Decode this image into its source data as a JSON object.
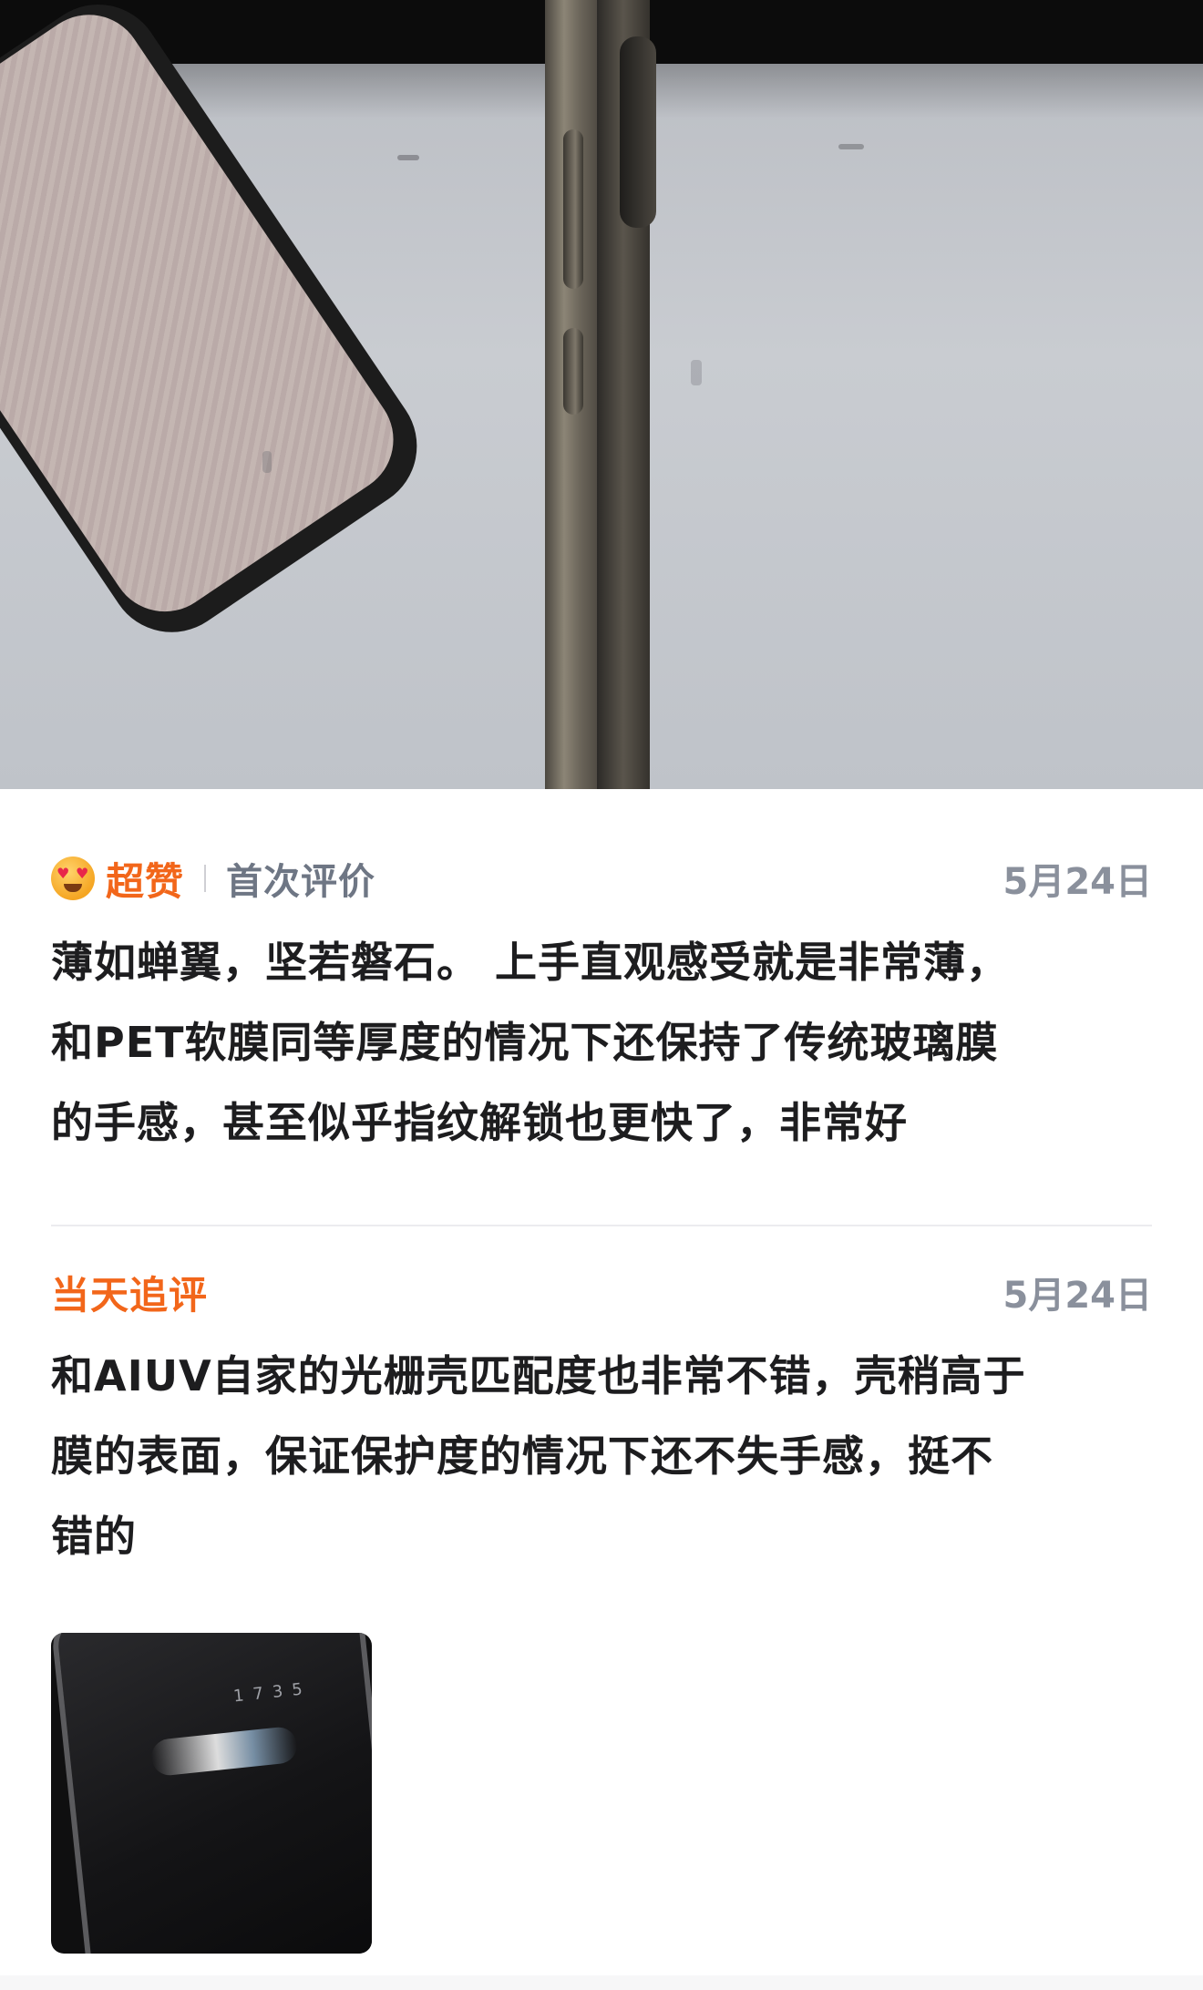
{
  "review": {
    "rating_label": "超赞",
    "tag": "首次评价",
    "date": "5月24日",
    "text_lines": [
      "薄如蝉翼，坚若磐石。 上手直观感受就是非常薄，",
      "和PET软膜同等厚度的情况下还保持了传统玻璃膜",
      "的手感，甚至似乎指纹解锁也更快了，非常好"
    ]
  },
  "follow_up": {
    "label": "当天追评",
    "date": "5月24日",
    "text_lines": [
      "和AIUV自家的光栅壳匹配度也非常不错，壳稍高于",
      "膜的表面，保证保护度的情况下还不失手感，挺不",
      "错的"
    ],
    "thumbnail_clock": "1735"
  },
  "colors": {
    "accent": "#f2661a",
    "text": "#1d1d1f",
    "muted": "#8a909c"
  }
}
